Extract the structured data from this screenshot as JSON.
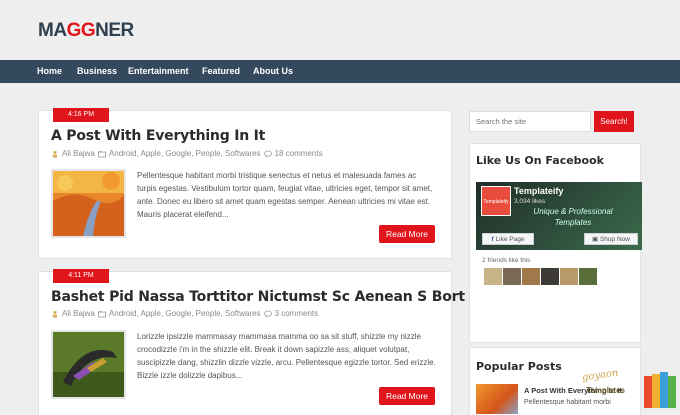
{
  "brand": {
    "prefix": "MA",
    "accent": "GG",
    "suffix": "NER"
  },
  "nav": {
    "items": [
      "Home",
      "Business",
      "Entertainment",
      "Featured",
      "About Us"
    ]
  },
  "posts": [
    {
      "time": "4:16 PM",
      "title": "A Post With Everything In It",
      "author": "Ali Bajwa",
      "categories": "Android, Apple, Google, People, Softwares",
      "comments": "18 comments",
      "excerpt": "Pellentesque habitant morbi tristique senectus et netus et malesuada fames ac turpis egestas. Vestibulum tortor quam, feugiat vitae, ultricies eget, tempor sit amet, ante. Donec eu libero sit amet quam egestas semper. Aenean ultricies mi vitae est. Mauris placerat eleifend...",
      "read_more": "Read More"
    },
    {
      "time": "4:11 PM",
      "title": "Bashet Pid Nassa Torttitor Nictumst Sc Aenean S Bort",
      "author": "Ali Bajwa",
      "categories": "Android, Apple, Google, People, Softwares",
      "comments": "3 comments",
      "excerpt": "Lorizzle ipsizzle mammasay mammasa mamma oo sa sit stuff, shizzle my nizzle crocodizzle i'm in the shizzle elit. Break it down sapizzle ass, aliquet volutpat, suscipizzle dang, shizzlin dizzle vizzle, arcu. Pellentesque egizzle tortor. Sed erizzle. Bizzle izzle dolizzle dapibus...",
      "read_more": "Read More"
    }
  ],
  "search": {
    "placeholder": "Search the site",
    "button": "Search!"
  },
  "facebook": {
    "heading": "Like Us On Facebook",
    "page_name": "Templateify",
    "likes": "3,034 likes",
    "tagline": "Unique & Professional Templates",
    "logo_text": "Templateify",
    "like_button": "Like Page",
    "shop_button": "Shop Now",
    "friends_text": "2 friends like this"
  },
  "popular": {
    "heading": "Popular Posts",
    "item_title": "A Post With Everything In It",
    "item_excerpt": "Pellentesque habitant morbi"
  },
  "watermark": {
    "line1": "goyaon",
    "line2": "Templates"
  },
  "colors": {
    "accent": "#e0141b",
    "nav_bg": "#34495e",
    "brand": "#2f4050"
  }
}
